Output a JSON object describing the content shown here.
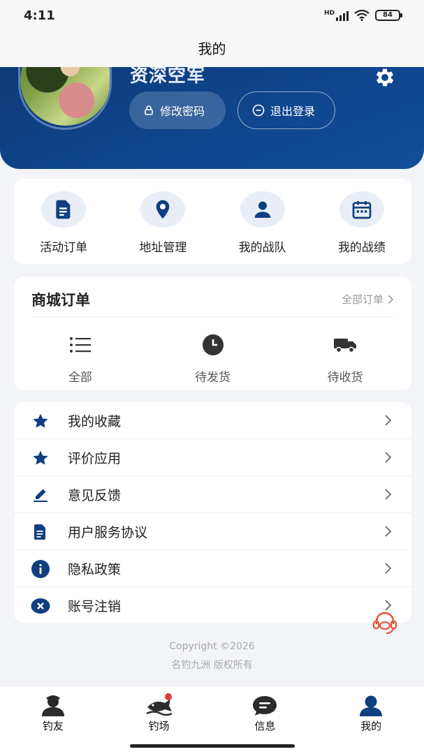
{
  "status_bar": {
    "time": "4:11",
    "battery": "84",
    "network_label": "HD"
  },
  "nav": {
    "title": "我的"
  },
  "profile": {
    "username": "资深空军",
    "change_password": "修改密码",
    "logout": "退出登录",
    "settings_icon": "gear-icon"
  },
  "quick_actions": [
    {
      "label": "活动订单",
      "icon": "document-icon"
    },
    {
      "label": "地址管理",
      "icon": "location-icon"
    },
    {
      "label": "我的战队",
      "icon": "person-icon"
    },
    {
      "label": "我的战绩",
      "icon": "calendar-icon"
    }
  ],
  "mall_orders": {
    "title": "商城订单",
    "view_all": "全部订单",
    "items": [
      {
        "label": "全部",
        "icon": "list-icon"
      },
      {
        "label": "待发货",
        "icon": "clock-icon"
      },
      {
        "label": "待收货",
        "icon": "truck-icon"
      }
    ]
  },
  "menu": [
    {
      "label": "我的收藏",
      "icon": "star-icon"
    },
    {
      "label": "评价应用",
      "icon": "star-icon"
    },
    {
      "label": "意见反馈",
      "icon": "edit-icon"
    },
    {
      "label": "用户服务协议",
      "icon": "document-icon"
    },
    {
      "label": "隐私政策",
      "icon": "info-icon"
    },
    {
      "label": "账号注销",
      "icon": "close-circle-icon"
    }
  ],
  "footer": {
    "copyright": "Copyright ©2026",
    "rights": "名钓九洲 版权所有"
  },
  "tabs": [
    {
      "label": "钓友",
      "icon": "user-group-icon"
    },
    {
      "label": "钓场",
      "icon": "fish-icon"
    },
    {
      "label": "信息",
      "icon": "message-icon"
    },
    {
      "label": "我的",
      "icon": "person-icon"
    }
  ],
  "colors": {
    "primary": "#0f4790",
    "background": "#f2f4f8",
    "badge": "#e53935",
    "support": "#e8502f"
  }
}
